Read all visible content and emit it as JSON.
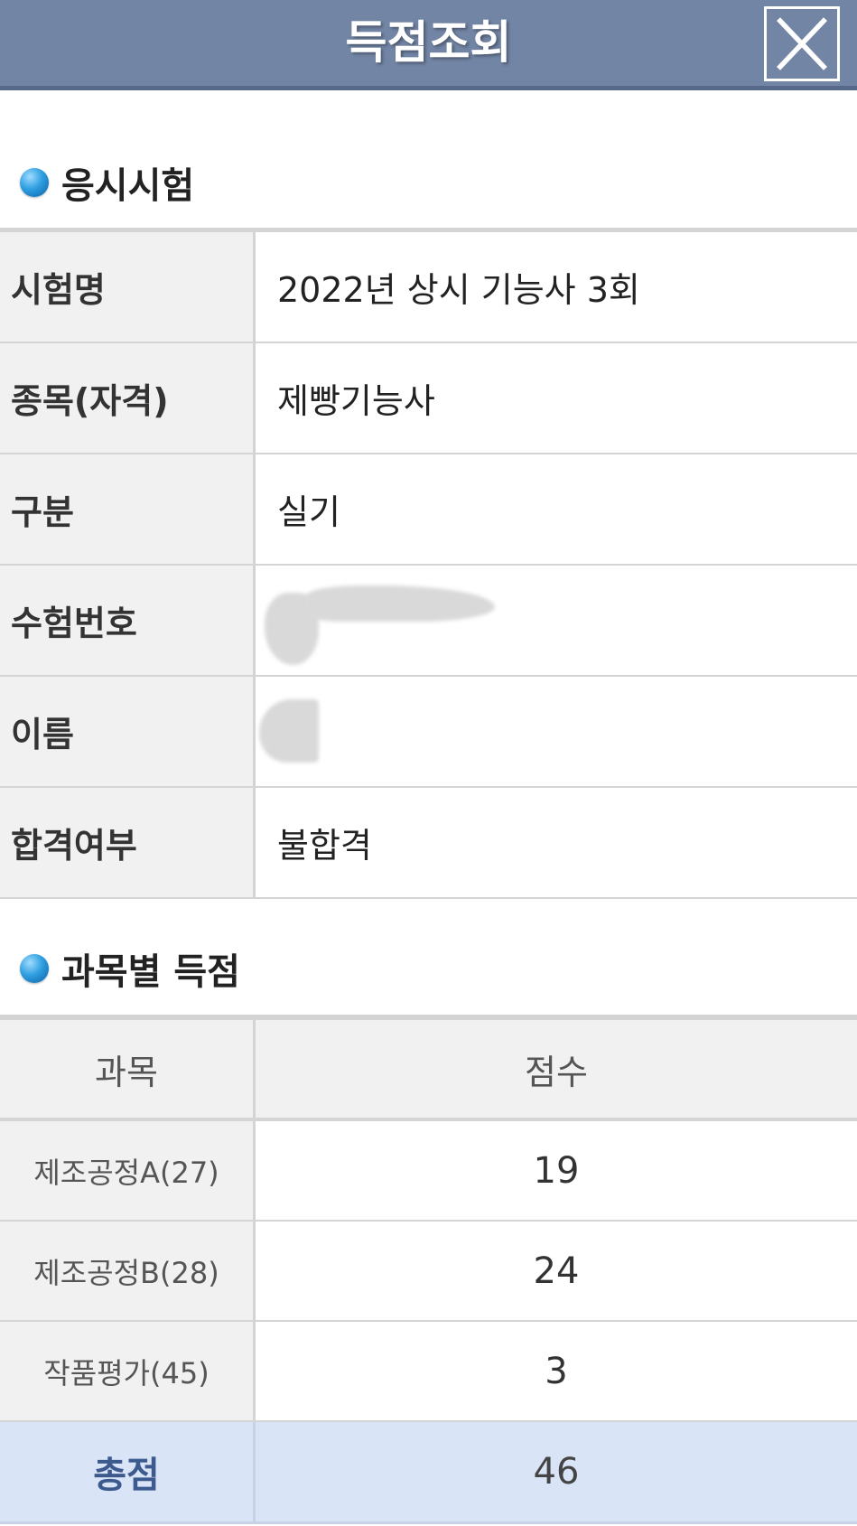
{
  "header": {
    "title": "득점조회",
    "close_icon": "close-x-icon"
  },
  "exam_section": {
    "title": "응시시험",
    "rows": [
      {
        "label": "시험명",
        "value": "2022년 상시 기능사 3회"
      },
      {
        "label": "종목(자격)",
        "value": "제빵기능사"
      },
      {
        "label": "구분",
        "value": "실기"
      },
      {
        "label": "수험번호",
        "value": ""
      },
      {
        "label": "이름",
        "value": ""
      },
      {
        "label": "합격여부",
        "value": "불합격"
      }
    ]
  },
  "score_section": {
    "title": "과목별 득점",
    "columns": [
      "과목",
      "점수"
    ],
    "rows": [
      {
        "subject": "제조공정A(27)",
        "score": "19"
      },
      {
        "subject": "제조공정B(28)",
        "score": "24"
      },
      {
        "subject": "작품평가(45)",
        "score": "3"
      }
    ],
    "total": {
      "label": "총점",
      "score": "46"
    }
  },
  "colors": {
    "header_bg": "#7285a5",
    "total_row_bg": "#d9e4f7",
    "total_label": "#3d5a8f"
  }
}
